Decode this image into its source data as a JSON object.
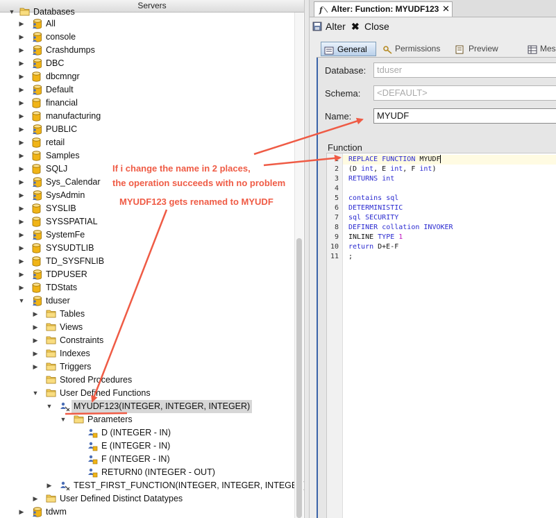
{
  "servers_panel": {
    "title": "Servers",
    "top_partial_label": "Databases",
    "items": [
      {
        "label": "All",
        "icon": "user-database-icon"
      },
      {
        "label": "console",
        "icon": "user-database-icon"
      },
      {
        "label": "Crashdumps",
        "icon": "user-database-icon"
      },
      {
        "label": "DBC",
        "icon": "user-database-icon"
      },
      {
        "label": "dbcmngr",
        "icon": "database-icon"
      },
      {
        "label": "Default",
        "icon": "user-database-icon"
      },
      {
        "label": "financial",
        "icon": "database-icon"
      },
      {
        "label": "manufacturing",
        "icon": "database-icon"
      },
      {
        "label": "PUBLIC",
        "icon": "user-database-icon"
      },
      {
        "label": "retail",
        "icon": "database-icon"
      },
      {
        "label": "Samples",
        "icon": "database-icon"
      },
      {
        "label": "SQLJ",
        "icon": "database-icon"
      },
      {
        "label": "Sys_Calendar",
        "icon": "user-database-icon"
      },
      {
        "label": "SysAdmin",
        "icon": "user-database-icon"
      },
      {
        "label": "SYSLIB",
        "icon": "database-icon"
      },
      {
        "label": "SYSSPATIAL",
        "icon": "database-icon"
      },
      {
        "label": "SystemFe",
        "icon": "user-database-icon"
      },
      {
        "label": "SYSUDTLIB",
        "icon": "database-icon"
      },
      {
        "label": "TD_SYSFNLIB",
        "icon": "database-icon"
      },
      {
        "label": "TDPUSER",
        "icon": "user-database-icon"
      },
      {
        "label": "TDStats",
        "icon": "database-icon"
      },
      {
        "label": "tduser",
        "icon": "user-database-icon"
      }
    ],
    "tduser_children": [
      {
        "label": "Tables"
      },
      {
        "label": "Views"
      },
      {
        "label": "Constraints"
      },
      {
        "label": "Indexes"
      },
      {
        "label": "Triggers"
      },
      {
        "label": "Stored Procedures"
      },
      {
        "label": "User Defined Functions"
      }
    ],
    "selected_function": "MYUDF123(INTEGER, INTEGER, INTEGER)",
    "parameters_label": "Parameters",
    "parameters": [
      "D (INTEGER - IN)",
      "E (INTEGER - IN)",
      "F (INTEGER - IN)",
      "RETURN0 (INTEGER - OUT)"
    ],
    "other_function": "TEST_FIRST_FUNCTION(INTEGER, INTEGER, INTEGER)",
    "udt_label": "User Defined Distinct Datatypes",
    "last_item": "tdwm"
  },
  "editor": {
    "tab_title": "Alter: Function: MYUDF123",
    "tab_close": "✕",
    "toolbar": {
      "alter_label": "Alter",
      "close_label": "Close"
    },
    "subtabs": [
      "General",
      "Permissions",
      "Preview SQL",
      "Mes"
    ],
    "form": {
      "database_label": "Database:",
      "database_value": "tduser",
      "schema_label": "Schema:",
      "schema_value": "<DEFAULT>",
      "name_label": "Name:",
      "name_value": "MYUDF"
    },
    "function_label": "Function",
    "code_lines": [
      "REPLACE FUNCTION MYUDF",
      "(D int, E int, F int)",
      "RETURNS int",
      "",
      "contains sql",
      "DETERMINISTIC",
      "sql SECURITY",
      "DEFINER collation INVOKER",
      "INLINE TYPE 1",
      "return D+E-F",
      ";"
    ]
  },
  "annotations": {
    "line1": "If i change the name in 2 places,",
    "line2": "the operation succeeds with no problem",
    "line3": "MYUDF123 gets renamed to MYUDF",
    "color": "#ef5b45"
  },
  "colors": {
    "selection": "#d7d7d7",
    "keyword": "#2a2ad0",
    "number": "#c019c0",
    "panel_accent": "#3a63a8"
  }
}
